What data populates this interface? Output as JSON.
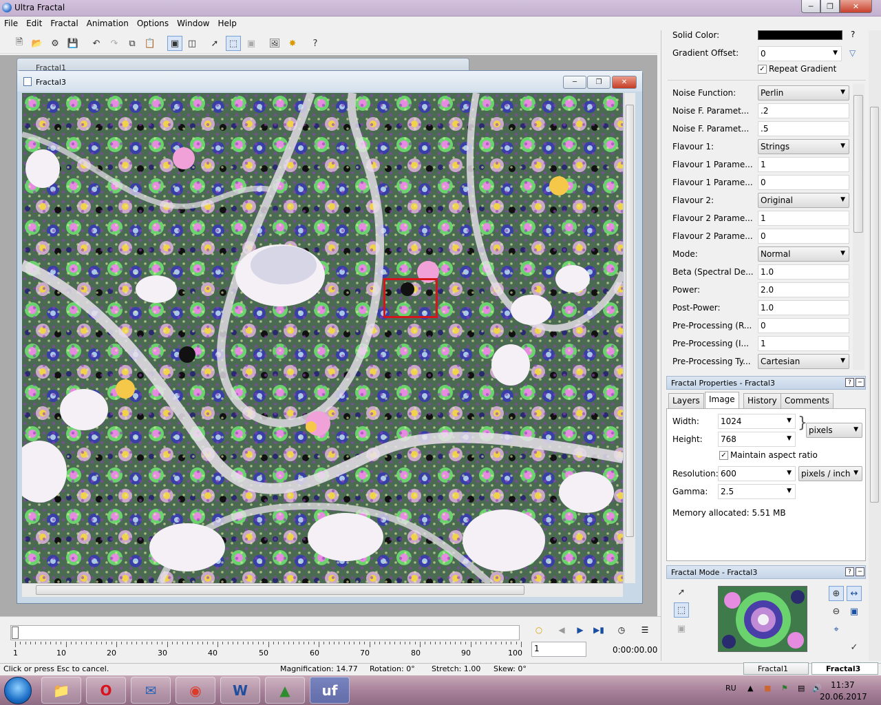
{
  "app": {
    "title": "Ultra Fractal"
  },
  "menu": [
    "File",
    "Edit",
    "Fractal",
    "Animation",
    "Options",
    "Window",
    "Help"
  ],
  "windows": {
    "fractal1_title": "Fractal1",
    "fractal3_title": "Fractal3"
  },
  "params": {
    "solid_color_label": "Solid Color:",
    "solid_color_value": "#000000",
    "gradient_offset_label": "Gradient Offset:",
    "gradient_offset_value": "0",
    "repeat_gradient_label": "Repeat Gradient",
    "help_glyph": "?",
    "rows": [
      {
        "label": "Noise Function:",
        "value": "Perlin",
        "type": "select"
      },
      {
        "label": "Noise F. Paramet...",
        "value": ".2",
        "type": "text"
      },
      {
        "label": "Noise F. Paramet...",
        "value": ".5",
        "type": "text"
      },
      {
        "label": "Flavour 1:",
        "value": "Strings",
        "type": "select"
      },
      {
        "label": "Flavour 1 Parame...",
        "value": "1",
        "type": "text"
      },
      {
        "label": "Flavour 1 Parame...",
        "value": "0",
        "type": "text"
      },
      {
        "label": "Flavour 2:",
        "value": "Original",
        "type": "select"
      },
      {
        "label": "Flavour 2 Parame...",
        "value": "1",
        "type": "text"
      },
      {
        "label": "Flavour 2 Parame...",
        "value": "0",
        "type": "text"
      },
      {
        "label": "Mode:",
        "value": "Normal",
        "type": "select"
      },
      {
        "label": "Beta (Spectral De...",
        "value": "1.0",
        "type": "text"
      },
      {
        "label": "Power:",
        "value": "2.0",
        "type": "text"
      },
      {
        "label": "Post-Power:",
        "value": "1.0",
        "type": "text"
      },
      {
        "label": "Pre-Processing (R...",
        "value": "0",
        "type": "text"
      },
      {
        "label": "Pre-Processing (I...",
        "value": "1",
        "type": "text"
      },
      {
        "label": "Pre-Processing Ty...",
        "value": "Cartesian",
        "type": "select"
      }
    ]
  },
  "properties": {
    "header": "Fractal Properties - Fractal3",
    "tabs": [
      "Layers",
      "Image",
      "History",
      "Comments"
    ],
    "active_tab": "Image",
    "width_label": "Width:",
    "width_value": "1024",
    "height_label": "Height:",
    "height_value": "768",
    "units": "pixels",
    "maintain_aspect_label": "Maintain aspect ratio",
    "resolution_label": "Resolution:",
    "resolution_value": "600",
    "resolution_units": "pixels / inch",
    "gamma_label": "Gamma:",
    "gamma_value": "2.5",
    "memory": "Memory allocated: 5.51 MB"
  },
  "mode_panel": {
    "header": "Fractal Mode - Fractal3"
  },
  "timeline": {
    "tick_labels": [
      "1",
      "10",
      "20",
      "30",
      "40",
      "50",
      "60",
      "70",
      "80",
      "90",
      "100"
    ],
    "frame_value": "1",
    "time": "0:00:00.00"
  },
  "status": {
    "hint": "Click or press Esc to cancel.",
    "magnification": "Magnification: 14.77",
    "rotation": "Rotation: 0°",
    "stretch": "Stretch: 1.00",
    "skew": "Skew: 0°",
    "doc_tabs": [
      "Fractal1",
      "Fractal3"
    ]
  },
  "taskbar": {
    "language": "RU",
    "time": "11:37",
    "date": "20.06.2017",
    "apps": [
      "explorer",
      "opera",
      "thunderbird",
      "chrome",
      "word",
      "app",
      "ultra-fractal"
    ]
  }
}
